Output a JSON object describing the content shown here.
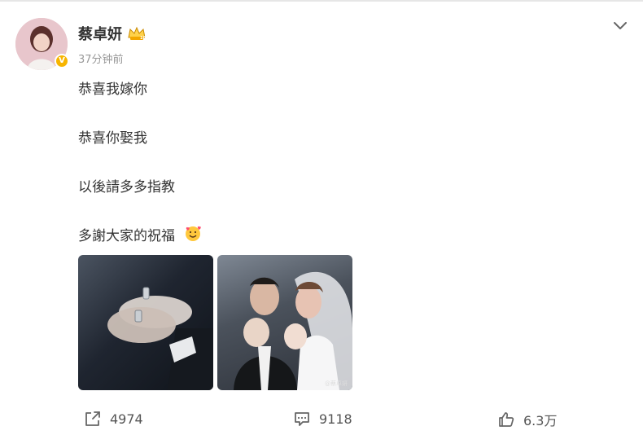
{
  "post": {
    "author": "蔡卓妍",
    "verified_badge": "V",
    "timestamp": "37分钟前",
    "lines": [
      "恭喜我嫁你",
      "恭喜你娶我",
      "以後請多多指教",
      "多謝大家的祝福"
    ],
    "emoji_icon": "smiling-face-with-hearts-icon",
    "member_icon": "crown-icon",
    "image_watermark": "@蔡卓妍"
  },
  "actions": {
    "repost_count": "4974",
    "comment_count": "9118",
    "like_count": "6.3万"
  },
  "colors": {
    "verified": "#f7b500",
    "text": "#333333",
    "meta": "#999999"
  }
}
